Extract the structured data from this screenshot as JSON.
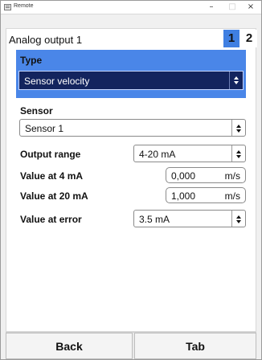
{
  "window": {
    "title": "Remote",
    "minimize": "–",
    "maximize": "□",
    "close": "×"
  },
  "header": {
    "title": "Analog output 1",
    "tabs": [
      {
        "label": "1",
        "active": true
      },
      {
        "label": "2",
        "active": false
      }
    ]
  },
  "type": {
    "label": "Type",
    "value": "Sensor velocity"
  },
  "sensor": {
    "label": "Sensor",
    "value": "Sensor 1"
  },
  "output_range": {
    "label": "Output range",
    "value": "4-20 mA"
  },
  "value_at_4ma": {
    "label": "Value at 4 mA",
    "value": "0,000",
    "unit": "m/s"
  },
  "value_at_20ma": {
    "label": "Value at 20 mA",
    "value": "1,000",
    "unit": "m/s"
  },
  "value_at_error": {
    "label": "Value at error",
    "value": "3.5 mA"
  },
  "footer": {
    "back_label": "Back",
    "tab_label": "Tab"
  },
  "colors": {
    "accent": "#4a86e8",
    "selected_bg": "#13245e",
    "active_tab": "#3f7fe2"
  }
}
